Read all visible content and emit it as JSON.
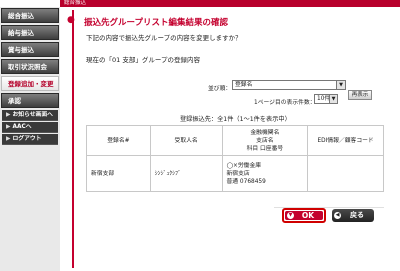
{
  "topbar": {
    "label": "総合振込"
  },
  "sidebar": {
    "items": [
      {
        "label": "総合振込",
        "active": false
      },
      {
        "label": "給与振込",
        "active": false
      },
      {
        "label": "賞与振込",
        "active": false
      },
      {
        "label": "取引状況照会",
        "active": false
      },
      {
        "label": "登録追加・変更",
        "active": true
      },
      {
        "label": "承認",
        "active": false
      }
    ],
    "subs": [
      {
        "label": "お知らせ画面へ",
        "arrow": "▶"
      },
      {
        "label": "AACへ",
        "arrow": "▶"
      },
      {
        "label": "ログアウト",
        "arrow": "▶"
      }
    ]
  },
  "page": {
    "title_bullet": "●",
    "title": "振込先グループリスト編集結果の確認",
    "subtitle": "下記の内容で振込先グループの内容を変更しますか？",
    "group_line": "現在の「01 支部」グループの登録内容"
  },
  "controls": {
    "sort_label": "並び順：",
    "sort_value": "登録名",
    "perpage_label": "1ページ目の表示件数：",
    "perpage_value": "10件",
    "dropdown_glyph": "▼",
    "redisplay_label": "再表示"
  },
  "count_text": "登録振込先：全1件（1〜1件を表示中）",
  "table": {
    "headers": [
      "登録名#",
      "受取人名",
      "金融機関名\n支店名\n科目 口座番号",
      "EDI情報／顧客コード"
    ],
    "rows": [
      [
        "新宿支部",
        "ｼﾝｼﾞｭｸｼﾌﾞ",
        "◯×労働金庫\n新宿支店\n普通 0768459",
        ""
      ]
    ]
  },
  "buttons": {
    "ok_label": "OK",
    "ok_icon": "▼",
    "back_label": "戻る",
    "back_icon": "◀"
  }
}
